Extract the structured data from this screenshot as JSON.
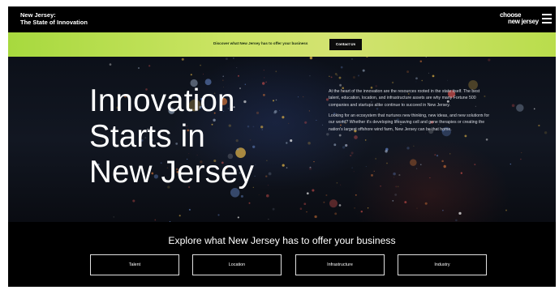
{
  "header": {
    "site_title_line1": "New Jersey:",
    "site_title_line2": "The State of Innovation",
    "logo_line1": "choose",
    "logo_line2": "new jersey",
    "menu_icon": "hamburger-menu-icon"
  },
  "banner": {
    "text": "Discover what New Jersey has to offer your business",
    "button_label": "Contact Us"
  },
  "hero": {
    "title_line1": "Innovation",
    "title_line2": "Starts in",
    "title_line3": "New Jersey",
    "paragraph1": "At the heart of the innovation are the resources rooted in the state itself. The best talent, education, location, and infrastructure assets are why many Fortune 500 companies and startups alike continue to succeed in New Jersey.",
    "paragraph2": "Looking for an ecosystem that nurtures new thinking, new ideas, and new solutions for our world? Whether it's developing lifesaving cell and gene therapies or creating the nation's largest offshore wind farm, New Jersey can be that home."
  },
  "explore": {
    "title": "Explore what New Jersey has to offer your business",
    "categories": [
      "Talent",
      "Location",
      "Infrastructure",
      "Industry"
    ]
  },
  "colors": {
    "background": "#000000",
    "banner_green": "#c4e05a",
    "text": "#ffffff"
  }
}
